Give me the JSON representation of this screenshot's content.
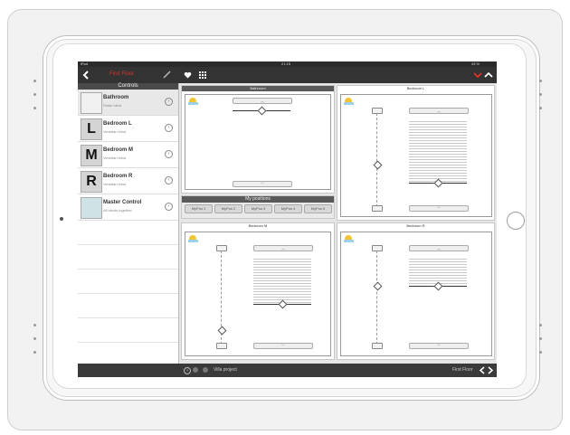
{
  "statusbar": {
    "left": "iPad",
    "time": "21:15",
    "battery": "43 %"
  },
  "topbar": {
    "title": "First Floor",
    "back_icon": "chevron-left-icon",
    "edit_icon": "pencil-icon",
    "heart_icon": "heart-icon",
    "grid_icon": "grid-icon",
    "down_icon": "chevron-down-icon",
    "up_icon": "chevron-up-icon"
  },
  "sidebar": {
    "header": "Controls",
    "items": [
      {
        "thumb": "",
        "name": "Bathroom",
        "sub": "Roller blind"
      },
      {
        "thumb": "L",
        "name": "Bedroom L",
        "sub": "Venetian blind"
      },
      {
        "thumb": "M",
        "name": "Bedroom M",
        "sub": "Venetian blind"
      },
      {
        "thumb": "R",
        "name": "Bedroom R",
        "sub": "Venetian blind"
      },
      {
        "thumb": "",
        "name": "Master Control",
        "sub": "All blinds together"
      }
    ]
  },
  "panels": {
    "bathroom": {
      "title": "Bathroom"
    },
    "bedroom_l": {
      "title": "Bedroom L"
    },
    "bedroom_m": {
      "title": "Bedroom M"
    },
    "bedroom_r": {
      "title": "Bedroom R"
    }
  },
  "my_positions": {
    "title": "My positions",
    "buttons": [
      "MyPos 1",
      "MyPos 2",
      "MyPos 3",
      "MyPos 4",
      "MyPos 5"
    ]
  },
  "bottombar": {
    "project": "Villa project",
    "floor": "First Floor"
  },
  "colors": {
    "accent": "#e0312b",
    "bar": "#333333"
  }
}
